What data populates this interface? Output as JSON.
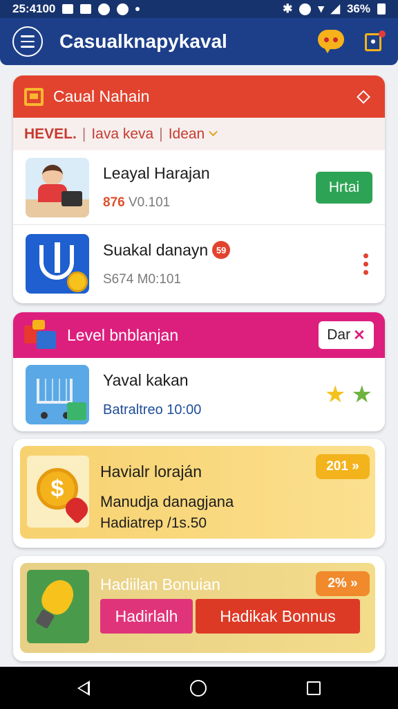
{
  "status_bar": {
    "time": "25:4100",
    "battery": "36%"
  },
  "app_bar": {
    "title": "Casualknapykaval"
  },
  "card1": {
    "header_title": "Caual Nahain",
    "filter": {
      "level": "HEVEL.",
      "option1": "Iava keva",
      "option2": "Idean"
    },
    "items": [
      {
        "title": "Leayal Harajan",
        "highlight": "876",
        "sub": "V0.101",
        "button": "Hrtai"
      },
      {
        "title": "Suakal danayn",
        "badge": "59",
        "sub": "S674 M0:101"
      }
    ]
  },
  "card2": {
    "header_title": "Level bnblanjan",
    "header_button": "Dar",
    "header_button_x": "✕",
    "item": {
      "title": "Yaval kakan",
      "sub": "Batraltreo 10:00"
    }
  },
  "card3": {
    "title": "Havialr loraján",
    "line2": "Manudja danagjana",
    "line3": "Hadiatrep /1s.50",
    "pill": "201 »"
  },
  "card4": {
    "title": "Hadiilan Bonuian",
    "pill": "2% »",
    "button_left": "Hadirlalh",
    "button_right": "Hadikak Bonnus"
  },
  "colors": {
    "app_bar": "#1d3f8a",
    "red_header": "#e2432e",
    "pink_header": "#dc1f7d",
    "green_button": "#2da455",
    "star_yellow": "#f4c21c",
    "star_green": "#6db33f"
  }
}
